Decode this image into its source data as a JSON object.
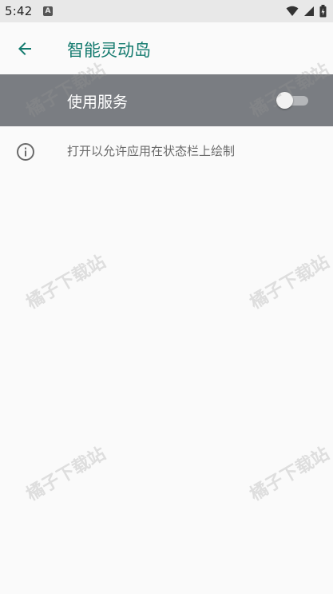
{
  "status_bar": {
    "time": "5:42",
    "notification_icon": "a-icon",
    "icons": [
      "wifi-icon",
      "cell-signal-icon",
      "battery-icon"
    ]
  },
  "app_bar": {
    "title": "智能灵动岛",
    "back_icon": "arrow-left-icon",
    "accent_color": "#137a6e"
  },
  "master_switch": {
    "label": "使用服务",
    "enabled": false,
    "background_color": "#7a7d82"
  },
  "info": {
    "icon": "info-icon",
    "text": "打开以允许应用在状态栏上绘制"
  },
  "watermark": {
    "text": "橘子下载站"
  }
}
